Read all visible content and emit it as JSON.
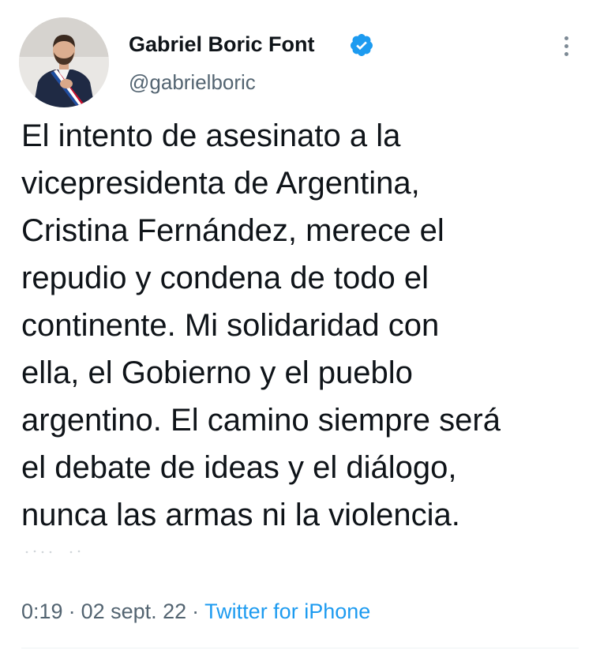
{
  "tweet": {
    "author": {
      "display_name": "Gabriel Boric Font",
      "handle": "@gabrielboric",
      "verified": true,
      "avatar_icon": "profile-photo"
    },
    "text": "El intento de asesinato a la\nvicepresidenta de Argentina,\nCristina Fernández, merece el\nrepudio y condena de todo el\ncontinente. Mi solidaridad con\nella, el Gobierno y el pueblo\nargentino. El camino siempre será\nel debate de ideas y el diálogo,\nnunca las armas ni la violencia.",
    "meta": {
      "time": "0:19",
      "separator": "·",
      "date": "02 sept. 22",
      "source": "Twitter for iPhone"
    }
  },
  "colors": {
    "text_primary": "#0f1419",
    "text_secondary": "#536471",
    "accent": "#1d9bf0"
  }
}
